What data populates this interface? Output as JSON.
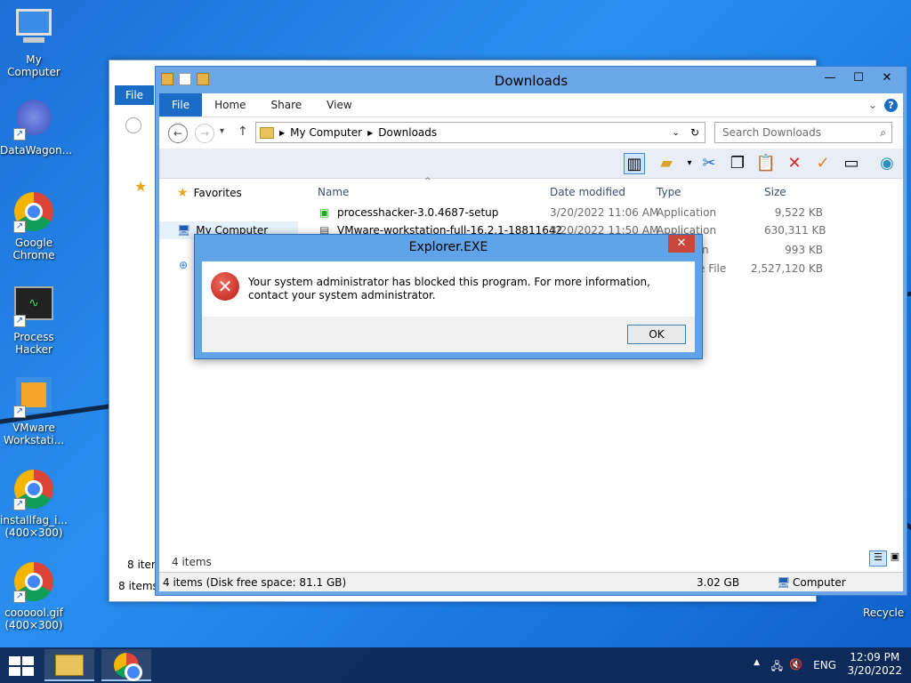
{
  "desktop": {
    "icons": [
      {
        "label": "My Computer"
      },
      {
        "label": "DataWagon..."
      },
      {
        "label": "Google Chrome"
      },
      {
        "label": "Process Hacker"
      },
      {
        "label": "VMware Workstati..."
      },
      {
        "label": "installfag_i... (400×300)"
      },
      {
        "label": "coooool.gif (400×300)"
      }
    ],
    "recycle": "Recycle"
  },
  "back_window": {
    "file_tab": "File",
    "nav_item": "8 iter",
    "status": "8 items"
  },
  "explorer": {
    "title": "Downloads",
    "tabs": [
      "File",
      "Home",
      "Share",
      "View"
    ],
    "breadcrumb": [
      "My Computer",
      "Downloads"
    ],
    "search_placeholder": "Search Downloads",
    "nav": {
      "favorites": "Favorites",
      "my_computer": "My Computer"
    },
    "columns": {
      "name": "Name",
      "date": "Date modified",
      "type": "Type",
      "size": "Size"
    },
    "files": [
      {
        "name": "processhacker-3.0.4687-setup",
        "date": "3/20/2022 11:06 AM",
        "type": "Application",
        "size": "9,522 KB"
      },
      {
        "name": "VMware-workstation-full-16.2.1-18811642",
        "date": "3/20/2022 11:50 AM",
        "type": "Application",
        "size": "630,311 KB"
      },
      {
        "name": "",
        "date": "",
        "type": "n",
        "size": "993 KB"
      },
      {
        "name": "",
        "date": "",
        "type": "e File",
        "size": "2,527,120 KB"
      }
    ],
    "item_count": "4 items",
    "status_left": "4 items (Disk free space: 81.1 GB)",
    "status_size": "3.02 GB",
    "status_location": "Computer"
  },
  "dialog": {
    "title": "Explorer.EXE",
    "message": "Your system administrator has blocked this program. For more information, contact your system administrator.",
    "ok_label": "OK"
  },
  "taskbar": {
    "lang": "ENG",
    "time": "12:09 PM",
    "date": "3/20/2022"
  },
  "colors": {
    "accent": "#1a6cc7",
    "error": "#c9463d"
  }
}
